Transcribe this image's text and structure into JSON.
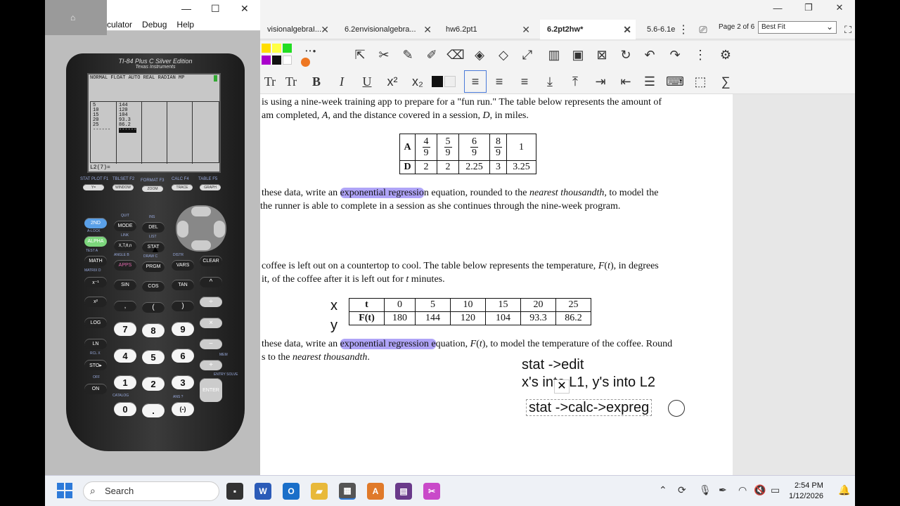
{
  "pdf_app": {
    "tabs": [
      {
        "label": "visionalgebraI...",
        "active": false
      },
      {
        "label": "6.2envisionalgebra...",
        "active": false
      },
      {
        "label": "hw6.2pt1",
        "active": false
      },
      {
        "label": "6.2pt2hw*",
        "active": true
      },
      {
        "label": "5.6-6.1e",
        "active": false
      }
    ],
    "page_info": "Page 2 of 6",
    "fit_mode": "Best Fit",
    "colors": [
      "#ffdd00",
      "#ffff44",
      "#22dd22",
      "#aa00cc",
      "#111111",
      "#ffffff",
      "#ee7722"
    ],
    "font_tools": [
      "Tr",
      "Tr",
      "B",
      "I",
      "U",
      "x²",
      "x₂"
    ],
    "document": {
      "q1_line1": "is using a nine-week training app to prepare for a \"fun run.\"  The table below represents the amount of",
      "q1_line2_a": "am completed, ",
      "q1_line2_A": "A",
      "q1_line2_b": ", and the distance covered in a session, ",
      "q1_line2_D": "D",
      "q1_line2_c": ", in miles.",
      "table1": {
        "row_a_label": "A",
        "row_a": [
          {
            "n": "4",
            "d": "9"
          },
          {
            "n": "5",
            "d": "9"
          },
          {
            "n": "6",
            "d": "9"
          },
          {
            "n": "8",
            "d": "9"
          },
          {
            "n": "1",
            "d": ""
          }
        ],
        "row_d_label": "D",
        "row_d": [
          "2",
          "2",
          "2.25",
          "3",
          "3.25"
        ]
      },
      "q1_task_a": " these data, write an ",
      "q1_task_hl": "exponential regressio",
      "q1_task_b": "n equation, rounded to the ",
      "q1_task_nt": "nearest thousandth",
      "q1_task_c": ", to model the",
      "q1_task_line2": "the runner is able to complete in a session as she continues through the nine-week program.",
      "q2_line1_a": "coffee is left out on a countertop to cool.  The table below represents the temperature, ",
      "q2_line1_F": "F",
      "q2_line1_b": "(",
      "q2_line1_t": "t",
      "q2_line1_c": "), in degrees",
      "q2_line2_a": "it, of the coffee after it is left out for ",
      "q2_line2_t": "t",
      "q2_line2_b": " minutes.",
      "table2": {
        "row_t_label": "t",
        "row_t": [
          "0",
          "5",
          "10",
          "15",
          "20",
          "25"
        ],
        "row_f_label": "F(t)",
        "row_f": [
          "180",
          "144",
          "120",
          "104",
          "93.3",
          "86.2"
        ]
      },
      "ann_x": "x",
      "ann_y": "y",
      "q2_task_a": " these data, write an ",
      "q2_task_hl": "exponential regression e",
      "q2_task_b": "quation, ",
      "q2_task_F": "F",
      "q2_task_c": "(",
      "q2_task_t": "t",
      "q2_task_d": "), to model the temperature of the coffee.  Round",
      "q2_task_line2_a": "s to the ",
      "q2_task_line2_nt": "nearest thousandth",
      "q2_task_line2_b": ".",
      "handwritten_1": "stat ->edit",
      "handwritten_2": "x's into L1, y's into L2",
      "handwritten_3": "stat ->calc->expreg"
    }
  },
  "emulator": {
    "menu": [
      "culator",
      "Debug",
      "Help"
    ],
    "brand": "TI-84 Plus C Silver Edition",
    "maker": "Texas Instruments",
    "screen": {
      "status": "NORMAL FLOAT AUTO REAL RADIAN MP",
      "l1": [
        "5",
        "10",
        "15",
        "20",
        "25",
        "------"
      ],
      "l2": [
        "144",
        "120",
        "104",
        "93.3",
        "86.2",
        "------"
      ],
      "prompt": "L2(7)="
    },
    "fkey_labels": [
      "STAT PLOT F1",
      "TBLSET F2",
      "FORMAT F3",
      "CALC F4",
      "TABLE F5"
    ],
    "fkeys": [
      "Y=",
      "WINDOW",
      "ZOOM",
      "TRACE",
      "GRAPH"
    ],
    "keys": {
      "second": "2ND",
      "mode": "MODE",
      "del": "DEL",
      "alpha": "ALPHA",
      "xt": "X,T,θ,n",
      "stat": "STAT",
      "math": "MATH",
      "apps": "APPS",
      "prgm": "PRGM",
      "vars": "VARS",
      "clear": "CLEAR",
      "inv": "x⁻¹",
      "sin": "SIN",
      "cos": "COS",
      "tan": "TAN",
      "pow": "^",
      "sq": "x²",
      "comma": ",",
      "lpar": "(",
      "rpar": ")",
      "div": "÷",
      "log": "LOG",
      "n7": "7",
      "n8": "8",
      "n9": "9",
      "mul": "×",
      "ln": "LN",
      "n4": "4",
      "n5": "5",
      "n6": "6",
      "minus": "−",
      "sto": "STO▸",
      "n1": "1",
      "n2": "2",
      "n3": "3",
      "plus": "+",
      "on": "ON",
      "n0": "0",
      "dot": ".",
      "neg": "(-)",
      "enter": "ENTER"
    },
    "sublabels": {
      "quit": "QUIT",
      "ins": "INS",
      "alock": "A-LOCK",
      "link": "LINK",
      "list": "LIST",
      "test": "TEST A",
      "angle": "ANGLE B",
      "draw": "DRAW C",
      "distr": "DISTR",
      "matrix": "MATRIX D",
      "catalog": "CATALOG",
      "entry": "ENTRY SOLVE",
      "off": "OFF",
      "rcl": "RCL X",
      "mem": "MEM",
      "ans": "ANS ?"
    }
  },
  "taskbar": {
    "search_placeholder": "Search",
    "time": "2:54 PM",
    "date": "1/12/2026"
  }
}
